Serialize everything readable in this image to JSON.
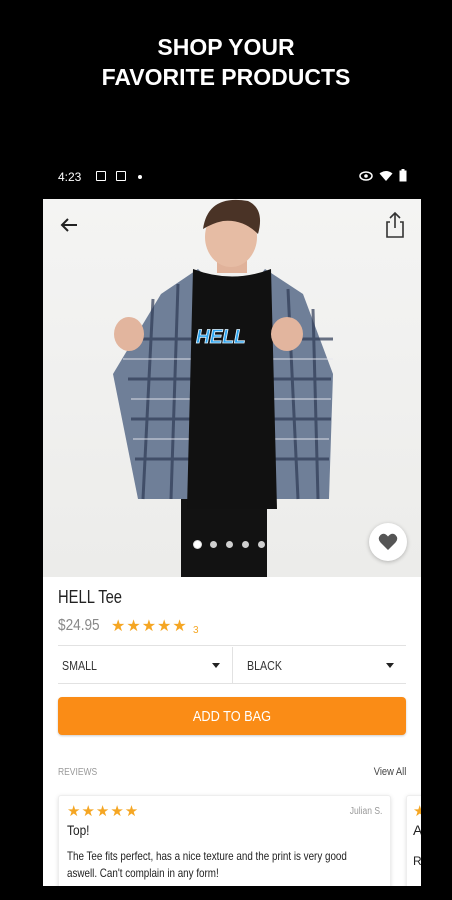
{
  "promo": {
    "line1": "SHOP YOUR",
    "line2": "FAVORITE PRODUCTS"
  },
  "status_bar": {
    "time": "4:23",
    "icons": [
      "image-icon",
      "calendar-icon",
      "dot-icon",
      "eye-icon",
      "wifi-icon",
      "battery-icon"
    ]
  },
  "product": {
    "name": "HELL Tee",
    "price": "$24.95",
    "rating_stars": "★★★★★",
    "rating_value": 5,
    "rating_count": "3",
    "print_text": "HELL",
    "image_count": 5,
    "active_image": 1
  },
  "options": {
    "size": "SMALL",
    "color": "BLACK"
  },
  "add_to_bag": "ADD TO BAG",
  "reviews": {
    "header": "REVIEWS",
    "view_all": "View All",
    "items": [
      {
        "stars": "★★★★★",
        "author": "Julian S.",
        "title": "Top!",
        "body": "The Tee fits perfect, has a nice texture and the print is very good aswell. Can't complain in any form!"
      },
      {
        "stars": "★",
        "title": "A",
        "body": "R"
      }
    ]
  },
  "colors": {
    "accent": "#fa8c16",
    "star": "#f5a623",
    "background": "#000000"
  }
}
